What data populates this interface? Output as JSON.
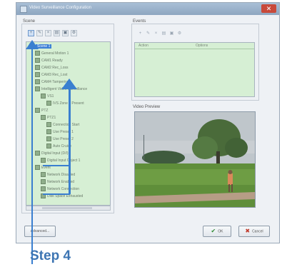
{
  "window": {
    "title": "Video Surveillance Configuration",
    "close_glyph": "✕"
  },
  "scene": {
    "label": "Scene",
    "toolbar": [
      "add-icon",
      "edit-icon",
      "delete-icon",
      "copy-icon",
      "paste-icon",
      "settings-icon"
    ],
    "tree": [
      {
        "label": "Scene 1",
        "depth": 0,
        "selected": true
      },
      {
        "label": "General Motion 1",
        "depth": 1
      },
      {
        "label": "CAM1 Ready",
        "depth": 1
      },
      {
        "label": "CAM2 Rec_Loss",
        "depth": 1
      },
      {
        "label": "CAM3 Rec_Lost",
        "depth": 1
      },
      {
        "label": "CAM4 Tampering",
        "depth": 1
      },
      {
        "label": "Intelligent Video Surveillance",
        "depth": 1
      },
      {
        "label": "VS1",
        "depth": 2
      },
      {
        "label": "IVS Zone 1 Present",
        "depth": 3
      },
      {
        "label": "PTZ",
        "depth": 1
      },
      {
        "label": "PTZ1",
        "depth": 2
      },
      {
        "label": "Connection Start",
        "depth": 3
      },
      {
        "label": "Use Preset 1",
        "depth": 3
      },
      {
        "label": "Use Preset 2",
        "depth": 3
      },
      {
        "label": "Auto Cruise",
        "depth": 3
      },
      {
        "label": "Digital Input (D/I)",
        "depth": 1
      },
      {
        "label": "Digital Input Object 1",
        "depth": 2
      },
      {
        "label": "Event",
        "depth": 1
      },
      {
        "label": "Network Disabled",
        "depth": 2
      },
      {
        "label": "Network Enabled",
        "depth": 2
      },
      {
        "label": "Network Connection",
        "depth": 2
      },
      {
        "label": "Disk Space Exhausted",
        "depth": 2
      }
    ]
  },
  "events": {
    "label": "Events",
    "toolbar": [
      "add-icon",
      "edit-icon",
      "delete-icon",
      "copy-icon",
      "paste-icon",
      "settings-icon"
    ],
    "columns": [
      "Action",
      "Options"
    ]
  },
  "video": {
    "label": "Video Preview"
  },
  "buttons": {
    "advanced": "Advanced...",
    "ok": "OK",
    "cancel": "Cancel",
    "ok_mark": "✔",
    "cancel_mark": "✖"
  },
  "annotation": {
    "step_label": "Step 4",
    "color": "#3a7fd0"
  }
}
